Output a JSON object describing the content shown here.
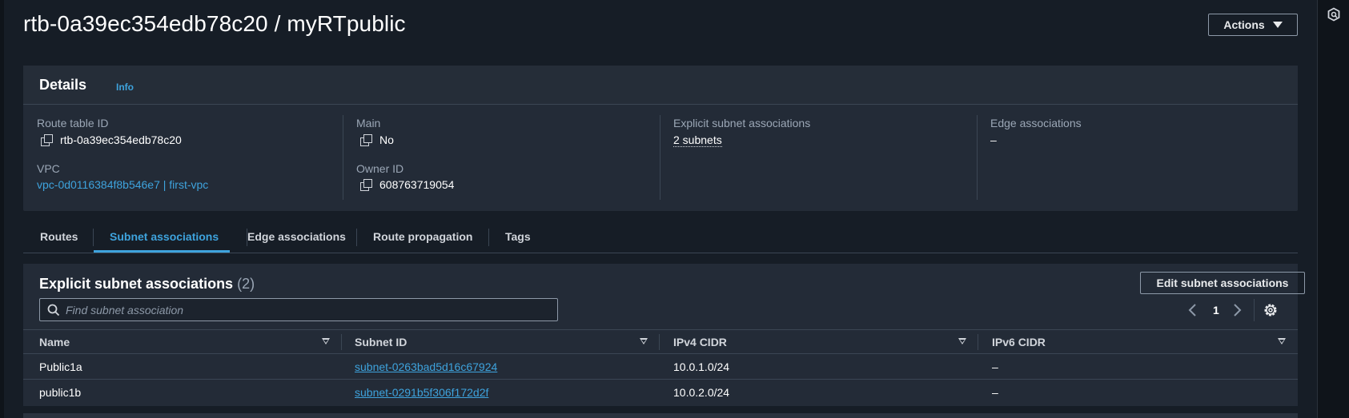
{
  "header": {
    "title": "rtb-0a39ec354edb78c20 / myRTpublic",
    "actions_label": "Actions"
  },
  "details": {
    "heading": "Details",
    "info_label": "Info",
    "route_table_id_label": "Route table ID",
    "route_table_id": "rtb-0a39ec354edb78c20",
    "vpc_label": "VPC",
    "vpc_value": "vpc-0d0116384f8b546e7 | first-vpc",
    "main_label": "Main",
    "main_value": "No",
    "owner_id_label": "Owner ID",
    "owner_id": "608763719054",
    "explicit_label": "Explicit subnet associations",
    "explicit_value": "2 subnets",
    "edge_label": "Edge associations",
    "edge_value": "–"
  },
  "tabs": [
    {
      "label": "Routes",
      "active": false
    },
    {
      "label": "Subnet associations",
      "active": true
    },
    {
      "label": "Edge associations",
      "active": false
    },
    {
      "label": "Route propagation",
      "active": false
    },
    {
      "label": "Tags",
      "active": false
    }
  ],
  "subnets": {
    "heading": "Explicit subnet associations",
    "count": "(2)",
    "edit_label": "Edit subnet associations",
    "search_placeholder": "Find subnet association",
    "page_number": "1",
    "columns": [
      "Name",
      "Subnet ID",
      "IPv4 CIDR",
      "IPv6 CIDR"
    ],
    "rows": [
      {
        "name": "Public1a",
        "subnet_id": "subnet-0263bad5d16c67924",
        "ipv4": "10.0.1.0/24",
        "ipv6": "–"
      },
      {
        "name": "public1b",
        "subnet_id": "subnet-0291b5f306f172d2f",
        "ipv4": "10.0.2.0/24",
        "ipv6": "–"
      }
    ]
  },
  "colors": {
    "background": "#161d26",
    "panel": "#232b37",
    "accent": "#3ea3dd",
    "text": "#ffffff"
  }
}
